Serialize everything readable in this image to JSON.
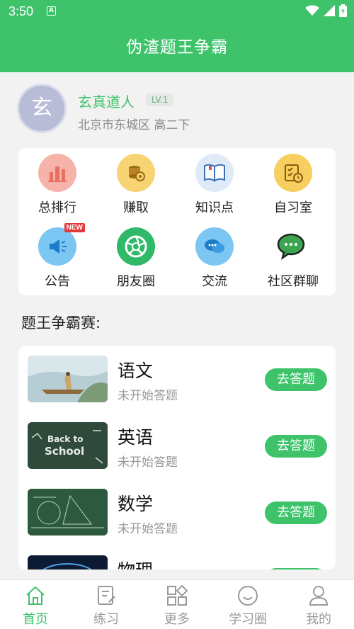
{
  "status_bar": {
    "time": "3:50",
    "notif_letter": "A"
  },
  "app": {
    "title": "伪渣题王争霸",
    "accent": "#3ec36b"
  },
  "profile": {
    "avatar_char": "玄",
    "name": "玄真道人",
    "level": "LV.1",
    "location": "北京市东城区 高二下"
  },
  "menu": [
    {
      "label": "总排行",
      "icon": "ranking-icon"
    },
    {
      "label": "赚取",
      "icon": "coins-icon"
    },
    {
      "label": "知识点",
      "icon": "book-icon"
    },
    {
      "label": "自习室",
      "icon": "study-room-icon"
    },
    {
      "label": "公告",
      "icon": "megaphone-icon",
      "badge": "NEW"
    },
    {
      "label": "朋友圈",
      "icon": "aperture-icon"
    },
    {
      "label": "交流",
      "icon": "chat-bubbles-icon"
    },
    {
      "label": "社区群聊",
      "icon": "wechat-icon"
    }
  ],
  "section_title": "题王争霸赛:",
  "subjects": [
    {
      "name": "语文",
      "status": "未开始答题",
      "button": "去答题"
    },
    {
      "name": "英语",
      "status": "未开始答题",
      "button": "去答题"
    },
    {
      "name": "数学",
      "status": "未开始答题",
      "button": "去答题"
    },
    {
      "name": "物理",
      "status": "",
      "button": ""
    }
  ],
  "thumb_text": {
    "english_line1": "Back to",
    "english_line2": "School"
  },
  "tabs": [
    {
      "label": "首页",
      "icon": "home-icon",
      "active": true
    },
    {
      "label": "练习",
      "icon": "exercise-icon"
    },
    {
      "label": "更多",
      "icon": "grid-icon"
    },
    {
      "label": "学习圈",
      "icon": "circle-chat-icon"
    },
    {
      "label": "我的",
      "icon": "user-icon"
    }
  ]
}
